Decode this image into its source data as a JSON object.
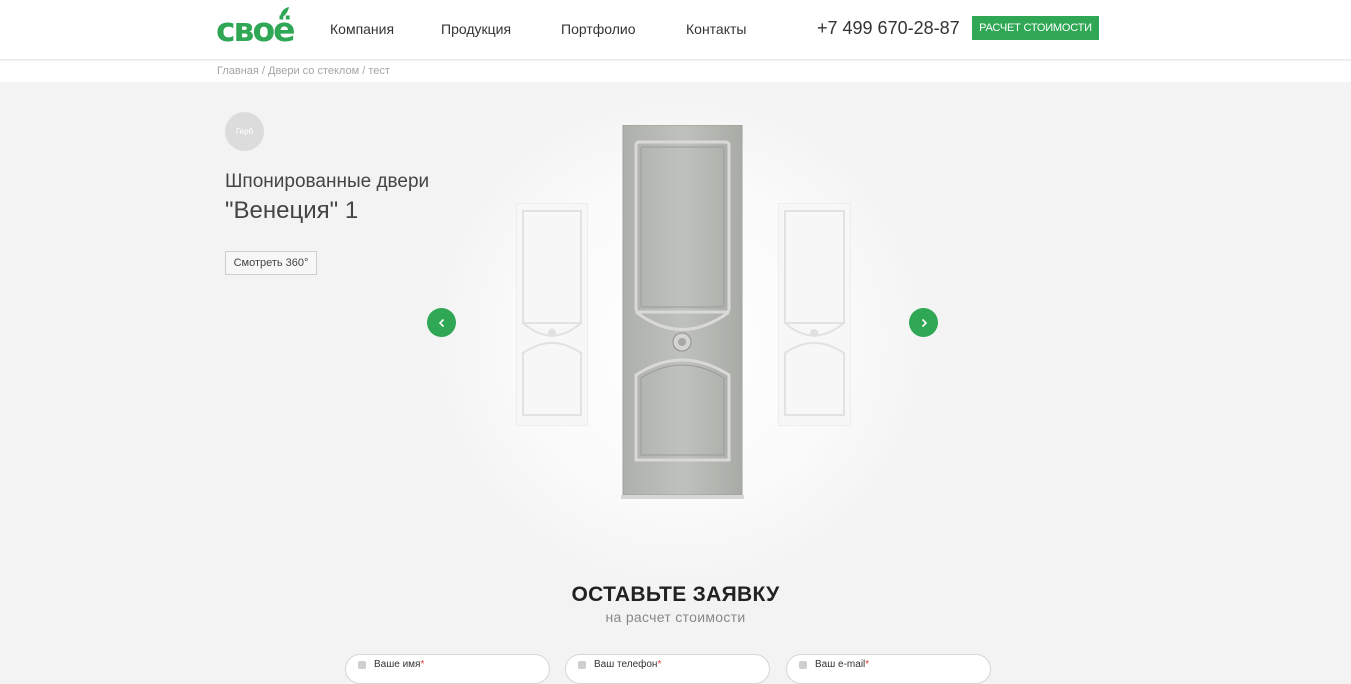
{
  "header": {
    "logo_text": "своё",
    "nav": [
      "Компания",
      "Продукция",
      "Портфолио",
      "Контакты"
    ],
    "phone": "+7 499 670-28-87",
    "cta_label": "РАСЧЕТ СТОИМОСТИ"
  },
  "breadcrumbs": {
    "items": [
      "Главная",
      "Двери со стеклом",
      "тест"
    ],
    "separator": " / "
  },
  "product": {
    "badge": "Герб",
    "title": "Шпонированные двери",
    "name": "\"Венеция\" 1",
    "view_360_label": "Смотреть 360°"
  },
  "slider": {
    "prev_icon": "chevron-left-icon",
    "next_icon": "chevron-right-icon"
  },
  "request_form": {
    "title": "ОСТАВЬТЕ ЗАЯВКУ",
    "subtitle": "на расчет стоимости",
    "fields": [
      {
        "placeholder": "Ваше имя",
        "required_mark": "*",
        "icon": "user-icon"
      },
      {
        "placeholder": "Ваш телефон",
        "required_mark": "*",
        "icon": "phone-icon"
      },
      {
        "placeholder": "Ваш e-mail",
        "required_mark": "*",
        "icon": "mail-icon"
      }
    ]
  },
  "colors": {
    "accent": "#2fa754",
    "background": "#f3f3f3",
    "door_main": "#b8bab5",
    "door_side": "#f6f6f6"
  }
}
